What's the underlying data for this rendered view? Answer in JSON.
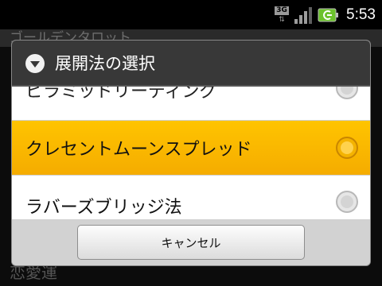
{
  "status_bar": {
    "network_label": "3G",
    "time": "5:53",
    "network_icon": "network-3g-icon",
    "signal_icon": "signal-strength-icon",
    "battery_icon": "battery-charging-icon"
  },
  "background_app": {
    "title": "ゴールデンタロット",
    "bottom_label": "恋愛運"
  },
  "dialog": {
    "title": "展開法の選択",
    "icon": "dropdown-circle-icon",
    "options": [
      {
        "label": "ピラミッドリーディング",
        "selected": false
      },
      {
        "label": "クレセントムーンスプレッド",
        "selected": false
      },
      {
        "label": "ラバーズブリッジ法",
        "selected": false
      }
    ],
    "cancel_label": "キャンセル"
  },
  "colors": {
    "highlight": "#ffc400",
    "header_bg": "#383838",
    "list_bg": "#ffffff"
  }
}
